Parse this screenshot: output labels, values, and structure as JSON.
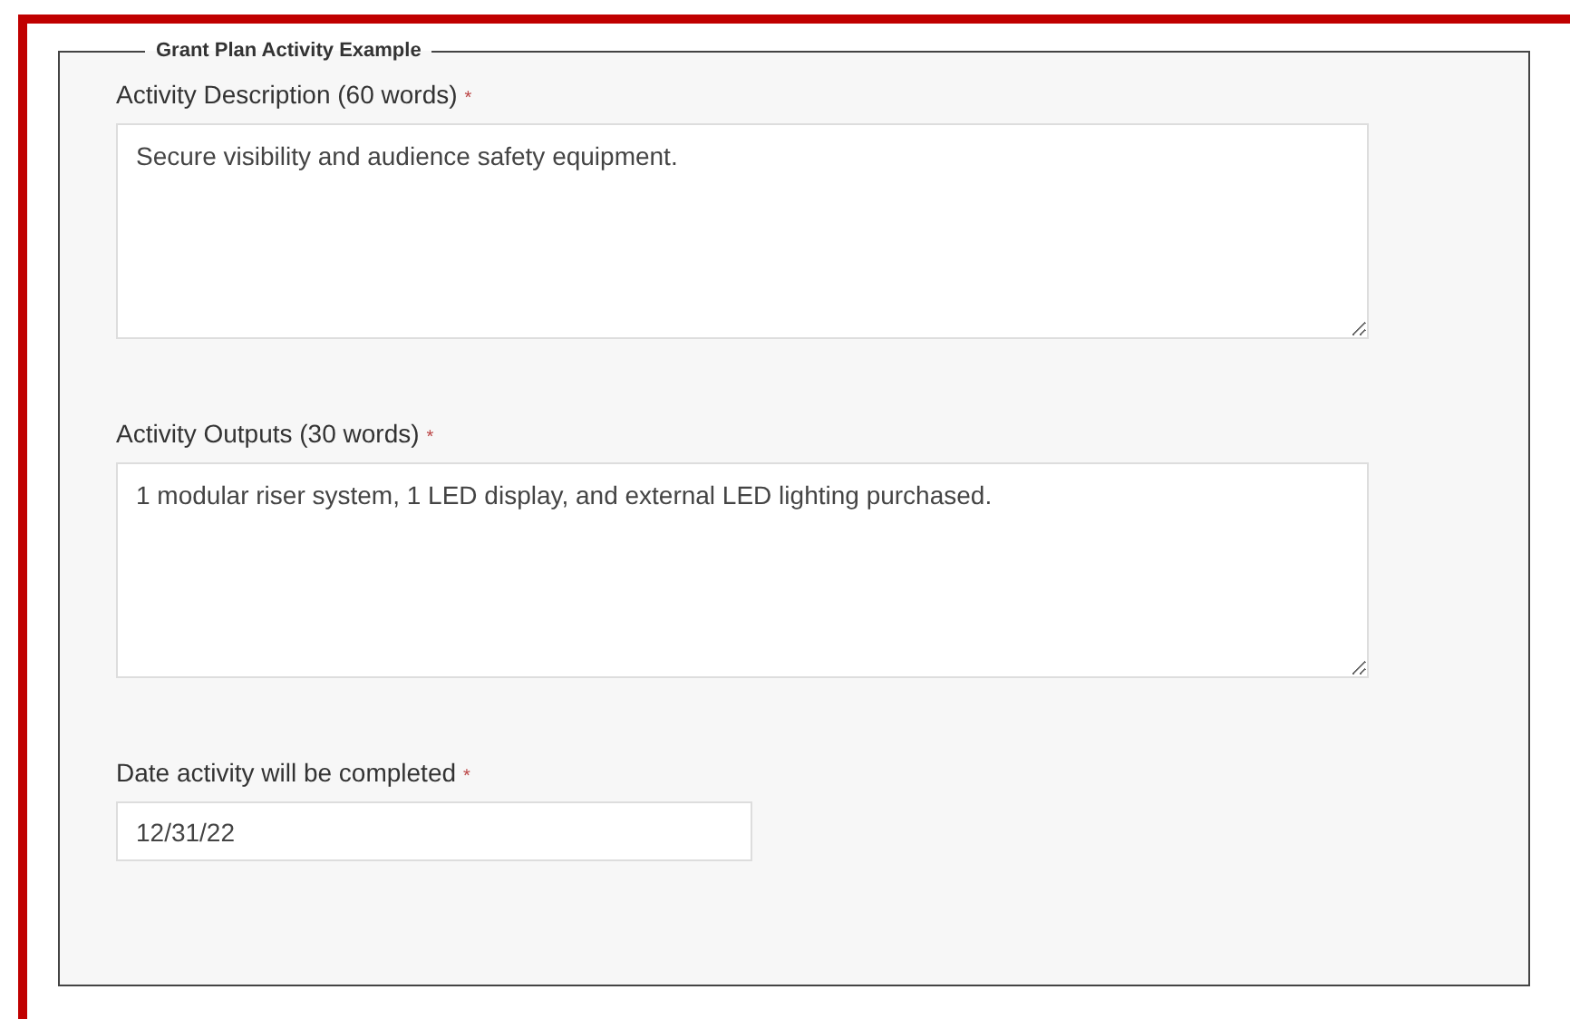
{
  "fieldset": {
    "legend": "Grant Plan Activity Example",
    "fields": [
      {
        "kind": "textarea",
        "label": "Activity Description (60 words)",
        "required_mark": "*",
        "value": "Secure visibility and audience safety equipment."
      },
      {
        "kind": "textarea",
        "label": "Activity Outputs (30 words)",
        "required_mark": "*",
        "value": "1 modular riser system, 1 LED display, and external LED lighting purchased."
      },
      {
        "kind": "date",
        "label": "Date activity will be completed",
        "required_mark": "*",
        "value": "12/31/22"
      }
    ]
  }
}
